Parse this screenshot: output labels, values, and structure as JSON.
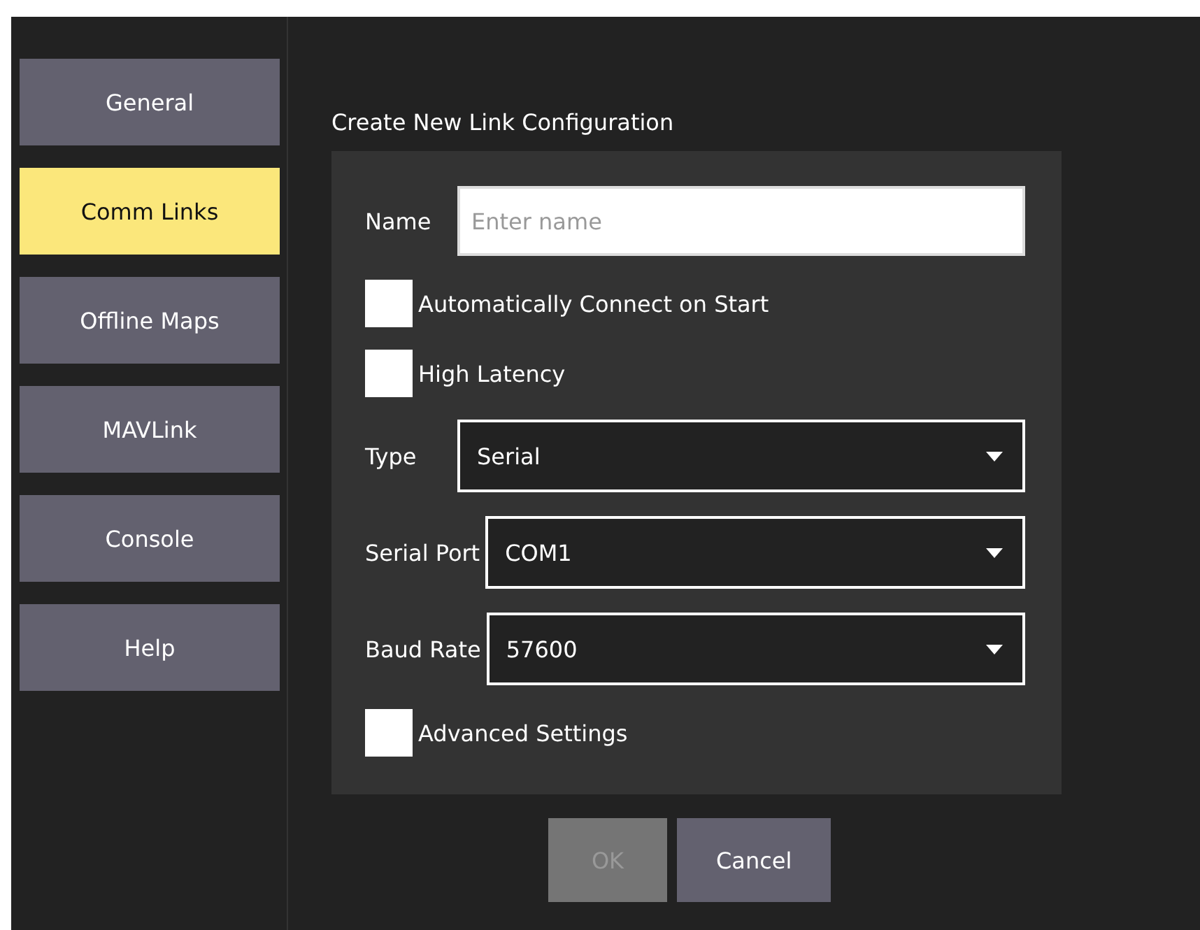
{
  "sidebar": {
    "items": [
      {
        "label": "General",
        "selected": false
      },
      {
        "label": "Comm Links",
        "selected": true
      },
      {
        "label": "Offline Maps",
        "selected": false
      },
      {
        "label": "MAVLink",
        "selected": false
      },
      {
        "label": "Console",
        "selected": false
      },
      {
        "label": "Help",
        "selected": false
      }
    ]
  },
  "dialog": {
    "title": "Create New Link Configuration",
    "rows": [
      {
        "kind": "text",
        "label": "Name",
        "placeholder": "Enter name"
      },
      {
        "kind": "checkbox",
        "label": "Automatically Connect on Start",
        "checked": false
      },
      {
        "kind": "checkbox",
        "label": "High Latency",
        "checked": false
      },
      {
        "kind": "select",
        "label": "Type",
        "value": "Serial"
      },
      {
        "kind": "select",
        "label": "Serial Port",
        "value": "COM1"
      },
      {
        "kind": "select",
        "label": "Baud Rate",
        "value": "57600"
      },
      {
        "kind": "checkbox",
        "label": "Advanced Settings",
        "checked": false
      }
    ],
    "buttons": [
      {
        "label": "OK",
        "disabled": true
      },
      {
        "label": "Cancel",
        "disabled": false
      }
    ]
  }
}
